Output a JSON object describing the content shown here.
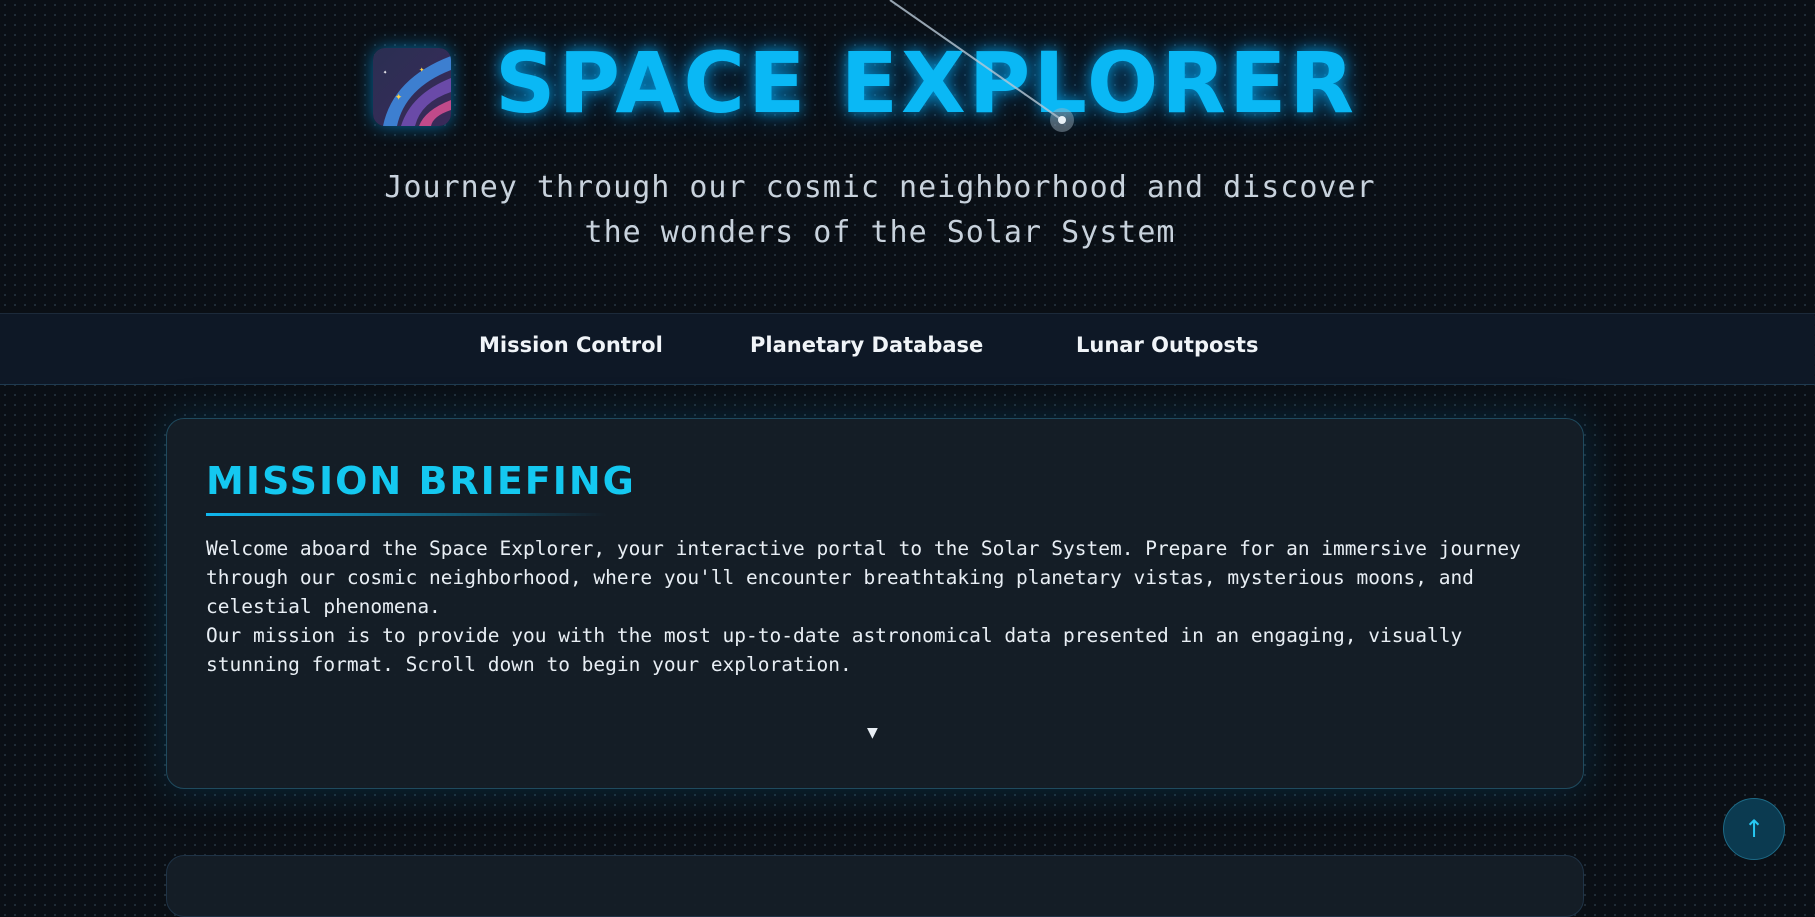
{
  "header": {
    "title": "SPACE EXPLORER",
    "subtitle_line1": "Journey through our cosmic neighborhood and discover",
    "subtitle_line2": "the wonders of the Solar System",
    "logo_icon": "comet-icon"
  },
  "nav": {
    "items": [
      {
        "label": "Mission Control"
      },
      {
        "label": "Planetary Database"
      },
      {
        "label": "Lunar Outposts"
      }
    ]
  },
  "briefing": {
    "title": "MISSION BRIEFING",
    "paragraph1": "Welcome aboard the Space Explorer, your interactive portal to the Solar System. Prepare for an immersive journey through our cosmic neighborhood, where you'll encounter breathtaking planetary vistas, mysterious moons, and celestial phenomena.",
    "paragraph2": "Our mission is to provide you with the most up-to-date astronomical data presented in an engaging, visually stunning format. Scroll down to begin your exploration.",
    "expand_glyph": "▼"
  },
  "scroll_top": {
    "glyph": "↑"
  },
  "colors": {
    "accent": "#0ab8f5",
    "background": "#0a0f15",
    "nav_background": "#0e1826"
  }
}
